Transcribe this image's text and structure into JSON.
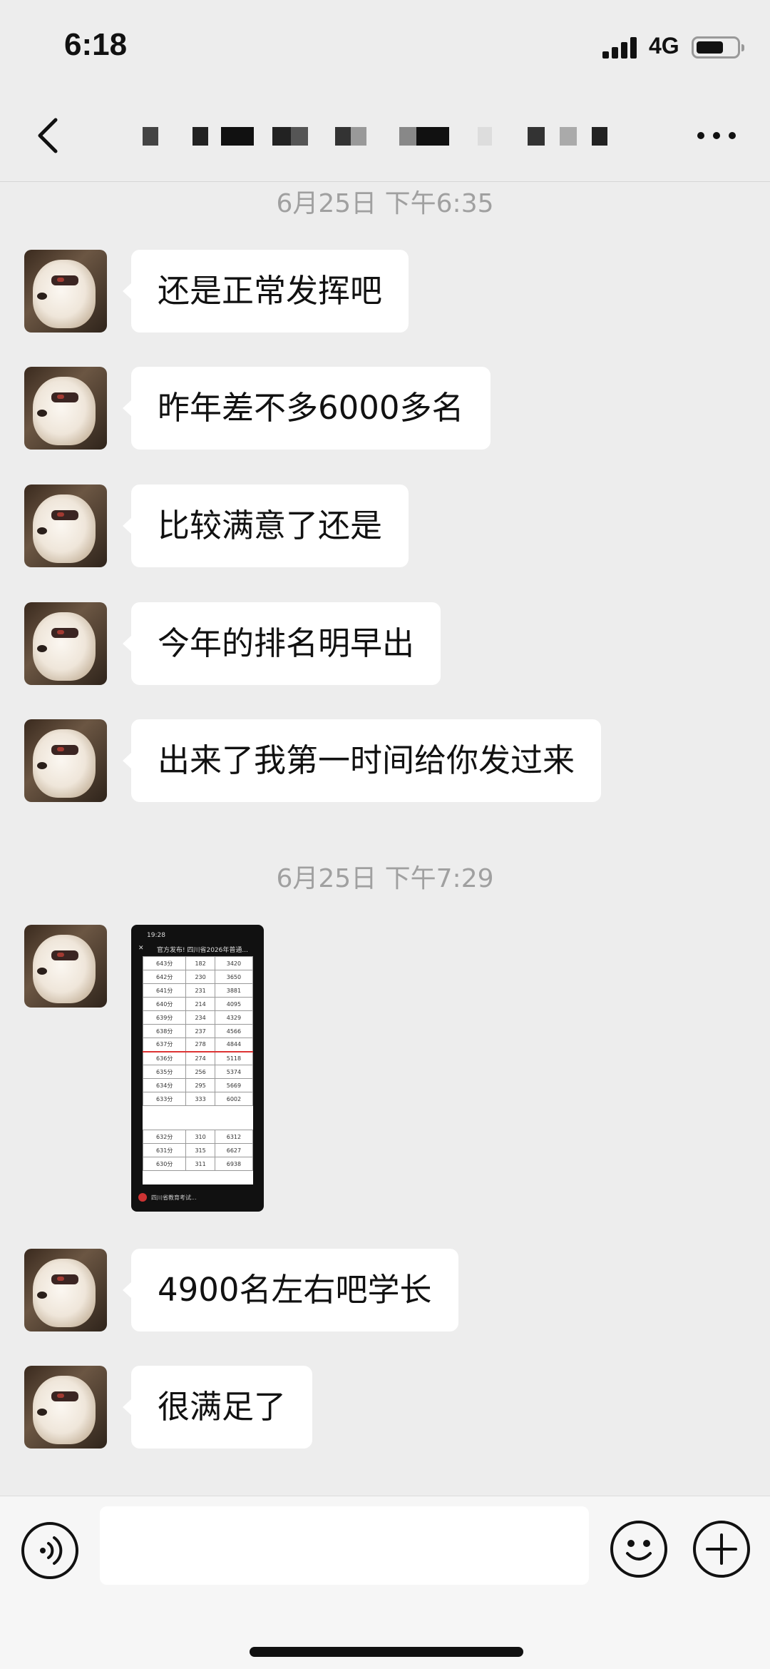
{
  "status_bar": {
    "time": "6:18",
    "network": "4G"
  },
  "nav": {
    "title": ""
  },
  "messages": [
    {
      "type": "timestamp",
      "text": "6月25日 下午6:35"
    },
    {
      "type": "text",
      "text": "还是正常发挥吧"
    },
    {
      "type": "text",
      "text": "昨年差不多6000多名"
    },
    {
      "type": "text",
      "text": "比较满意了还是"
    },
    {
      "type": "text",
      "text": "今年的排名明早出"
    },
    {
      "type": "text",
      "text": "出来了我第一时间给你发过来"
    },
    {
      "type": "timestamp",
      "text": "6月25日 下午7:29"
    },
    {
      "type": "image",
      "screenshot": {
        "time": "19:28",
        "title": "官方发布! 四川省2026年普通...",
        "rows": [
          [
            "643分",
            "182",
            "3420"
          ],
          [
            "642分",
            "230",
            "3650"
          ],
          [
            "641分",
            "231",
            "3881"
          ],
          [
            "640分",
            "214",
            "4095"
          ],
          [
            "639分",
            "234",
            "4329"
          ],
          [
            "638分",
            "237",
            "4566"
          ],
          [
            "637分",
            "278",
            "4844"
          ],
          [
            "636分",
            "274",
            "5118"
          ],
          [
            "635分",
            "256",
            "5374"
          ],
          [
            "634分",
            "295",
            "5669"
          ],
          [
            "633分",
            "333",
            "6002"
          ],
          [
            "632分",
            "310",
            "6312"
          ],
          [
            "631分",
            "315",
            "6627"
          ],
          [
            "630分",
            "311",
            "6938"
          ]
        ],
        "footer": "四川省教育考试..."
      }
    },
    {
      "type": "text",
      "text": "4900名左右吧学长"
    },
    {
      "type": "text",
      "text": "很满足了"
    }
  ],
  "input": {
    "placeholder": ""
  }
}
